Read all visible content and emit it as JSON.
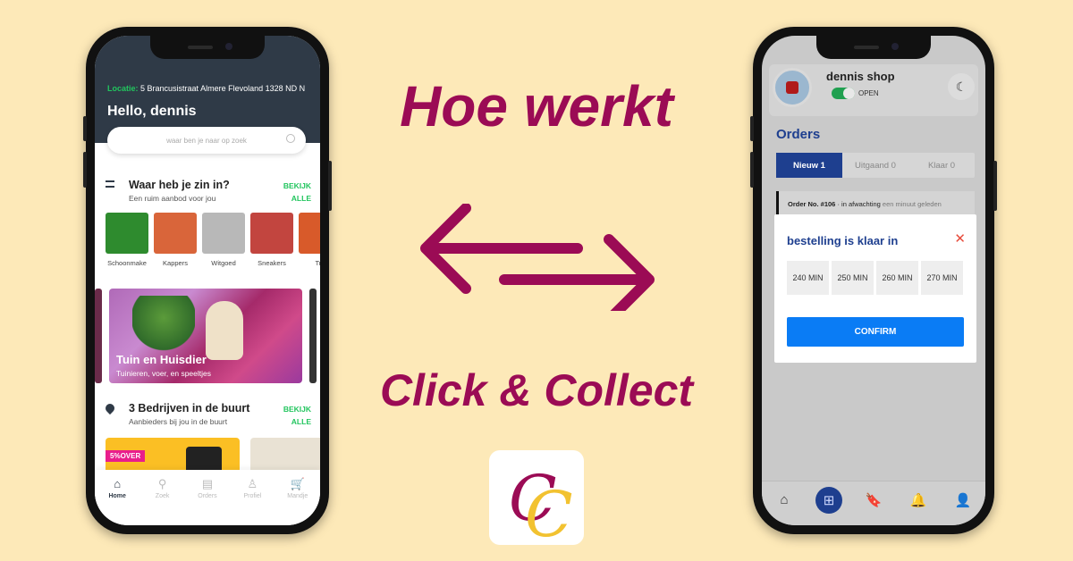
{
  "headline": {
    "line1": "Hoe werkt",
    "line2": "Click & Collect",
    "color": "#9b0b55"
  },
  "logo": {
    "letters": "CC",
    "colors": [
      "#9b0b55",
      "#f2c230"
    ]
  },
  "customer_app": {
    "location_label": "Locatie:",
    "location_value": "5 Brancusistraat Almere Flevoland 1328 ND N",
    "greeting": "Hello, dennis",
    "search_placeholder": "waar ben je naar op zoek",
    "section1": {
      "title": "Waar heb je zin in?",
      "subtitle": "Een ruim aanbod voor jou",
      "action_line1": "BEKIJK",
      "action_line2": "ALLE"
    },
    "categories": [
      {
        "label": "Schoonmake",
        "color": "#2e8b2e"
      },
      {
        "label": "Kappers",
        "color": "#d9653a"
      },
      {
        "label": "Witgoed",
        "color": "#b8b8b8"
      },
      {
        "label": "Sneakers",
        "color": "#c2453f"
      },
      {
        "label": "Tru",
        "color": "#d85a2a"
      }
    ],
    "banner": {
      "title": "Tuin en Huisdier",
      "subtitle": "Tuinieren, voer, en speeltjes"
    },
    "section2": {
      "title": "3 Bedrijven in de buurt",
      "subtitle": "Aanbieders bij jou in de buurt",
      "action_line1": "BEKIJK",
      "action_line2": "ALLE"
    },
    "promo_badge": "5%OVER",
    "nav": [
      {
        "label": "Home",
        "icon": "home-icon",
        "glyph": "⌂",
        "active": true
      },
      {
        "label": "Zoek",
        "icon": "search-icon",
        "glyph": "⚲",
        "active": false
      },
      {
        "label": "Orders",
        "icon": "orders-icon",
        "glyph": "▤",
        "active": false
      },
      {
        "label": "Profiel",
        "icon": "profile-icon",
        "glyph": "♙",
        "active": false
      },
      {
        "label": "Mandje",
        "icon": "cart-icon",
        "glyph": "🛒",
        "active": false
      }
    ],
    "accent": "#22c55e",
    "header_bg": "#2f3a47"
  },
  "merchant_app": {
    "shop_name": "dennis shop",
    "status": "OPEN",
    "status_on": true,
    "orders_title": "Orders",
    "tabs": [
      {
        "label": "Nieuw 1",
        "active": true
      },
      {
        "label": "Uitgaand 0",
        "active": false
      },
      {
        "label": "Klaar 0",
        "active": false
      }
    ],
    "order": {
      "number": "Order No. #106",
      "status": "in afwachting",
      "time": "een minuut geleden"
    },
    "modal": {
      "title": "bestelling is klaar in",
      "options": [
        "240 MIN",
        "250 MIN",
        "260 MIN",
        "270 MIN"
      ],
      "confirm_label": "CONFIRM"
    },
    "nav": [
      {
        "icon": "home-icon",
        "glyph": "⌂",
        "active": false
      },
      {
        "icon": "grid-icon",
        "glyph": "⊞",
        "active": true
      },
      {
        "icon": "bookmark-icon",
        "glyph": "🔖",
        "active": false
      },
      {
        "icon": "bell-icon",
        "glyph": "🔔",
        "active": false
      },
      {
        "icon": "user-icon",
        "glyph": "👤",
        "active": false
      }
    ],
    "primary": "#1e3f8f",
    "confirm_color": "#0a7cf5"
  }
}
